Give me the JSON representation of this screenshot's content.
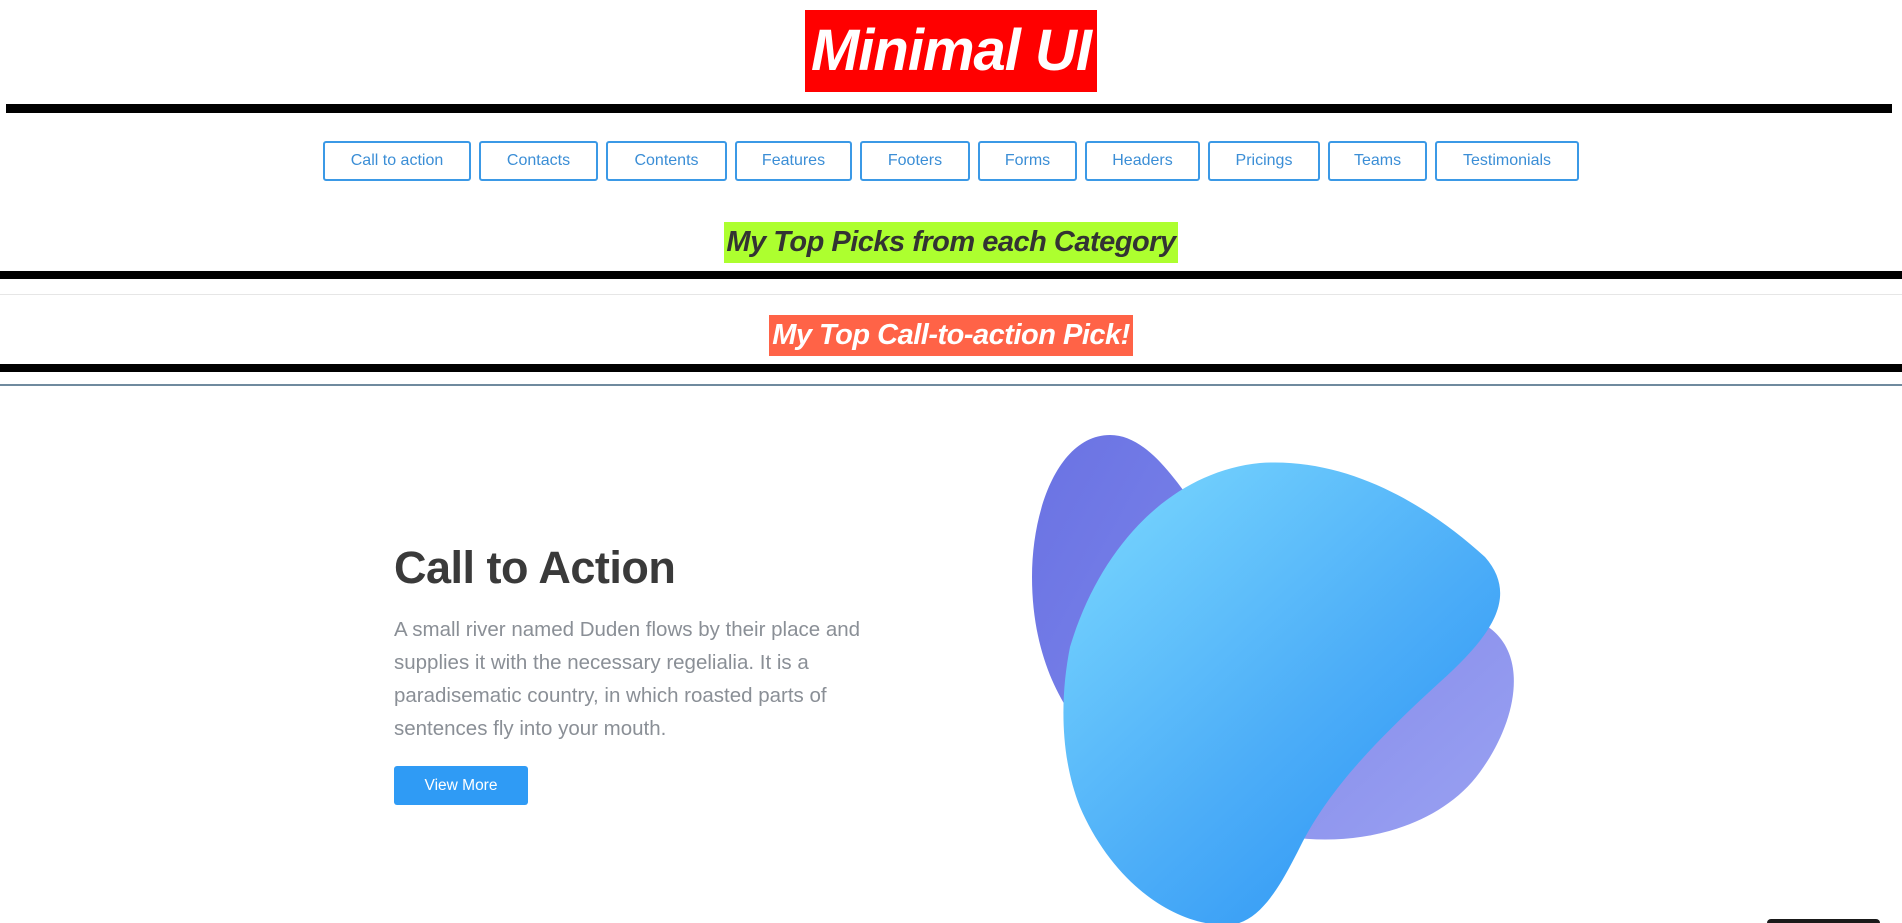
{
  "brand": {
    "title": "Minimal UI",
    "color": "#ff0000"
  },
  "nav": {
    "items": [
      {
        "label": "Call to action"
      },
      {
        "label": "Contacts"
      },
      {
        "label": "Contents"
      },
      {
        "label": "Features"
      },
      {
        "label": "Footers"
      },
      {
        "label": "Forms"
      },
      {
        "label": "Headers"
      },
      {
        "label": "Pricings"
      },
      {
        "label": "Teams"
      },
      {
        "label": "Testimonials"
      }
    ],
    "accent": "#3b99e6"
  },
  "sections": {
    "top_picks": {
      "heading": "My Top Picks from each Category",
      "highlight": "#adff2f"
    },
    "cta_pick": {
      "heading": "My Top Call-to-action Pick!",
      "highlight": "#ff6347"
    }
  },
  "cta": {
    "title": "Call to Action",
    "text": "A small river named Duden flows by their place and supplies it with the necessary regelialia. It is a paradisematic country, in which roasted parts of sentences fly into your mouth.",
    "button_label": "View More",
    "button_color": "#2f9bf5",
    "illustration": "abstract-blob-shapes"
  }
}
